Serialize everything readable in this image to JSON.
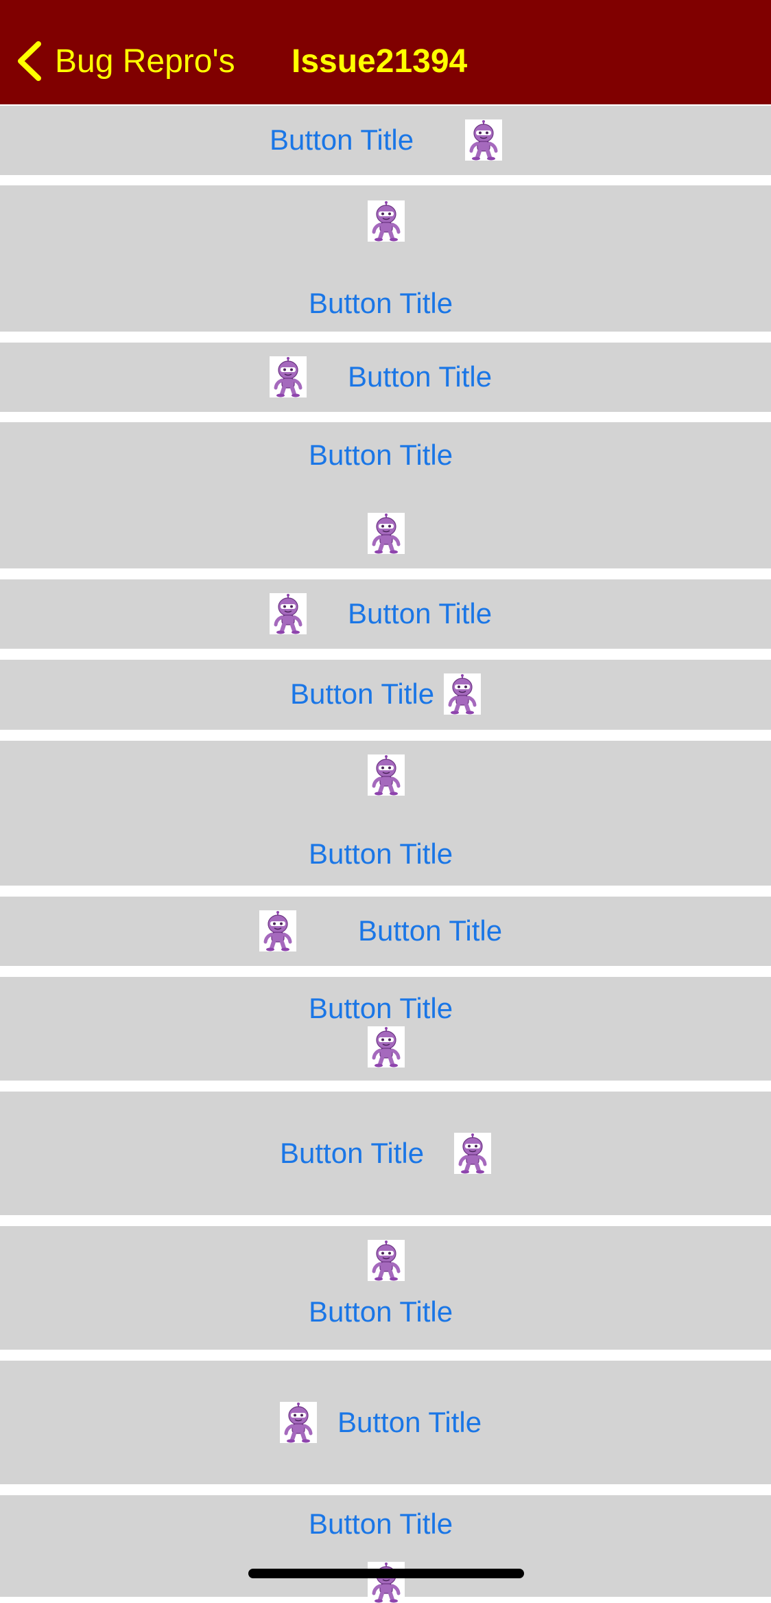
{
  "nav": {
    "back_label": "Bug Repro's",
    "title": "Issue21394"
  },
  "buttons": [
    {
      "title": "Button Title",
      "image": "dotnet-bot-icon"
    },
    {
      "title": "Button Title",
      "image": "dotnet-bot-icon"
    },
    {
      "title": "Button Title",
      "image": "dotnet-bot-icon"
    },
    {
      "title": "Button Title",
      "image": "dotnet-bot-icon"
    },
    {
      "title": "Button Title",
      "image": "dotnet-bot-icon"
    },
    {
      "title": "Button Title",
      "image": "dotnet-bot-icon"
    },
    {
      "title": "Button Title",
      "image": "dotnet-bot-icon"
    },
    {
      "title": "Button Title",
      "image": "dotnet-bot-icon"
    },
    {
      "title": "Button Title",
      "image": "dotnet-bot-icon"
    },
    {
      "title": "Button Title",
      "image": "dotnet-bot-icon"
    },
    {
      "title": "Button Title",
      "image": "dotnet-bot-icon"
    },
    {
      "title": "Button Title",
      "image": "dotnet-bot-icon"
    },
    {
      "title": "Button Title",
      "image": "dotnet-bot-icon"
    }
  ],
  "colors": {
    "nav_background": "#800000",
    "nav_text": "#ffff00",
    "button_background": "#d3d3d3",
    "button_text": "#1a76e6",
    "bot_color": "#9b59b6"
  }
}
